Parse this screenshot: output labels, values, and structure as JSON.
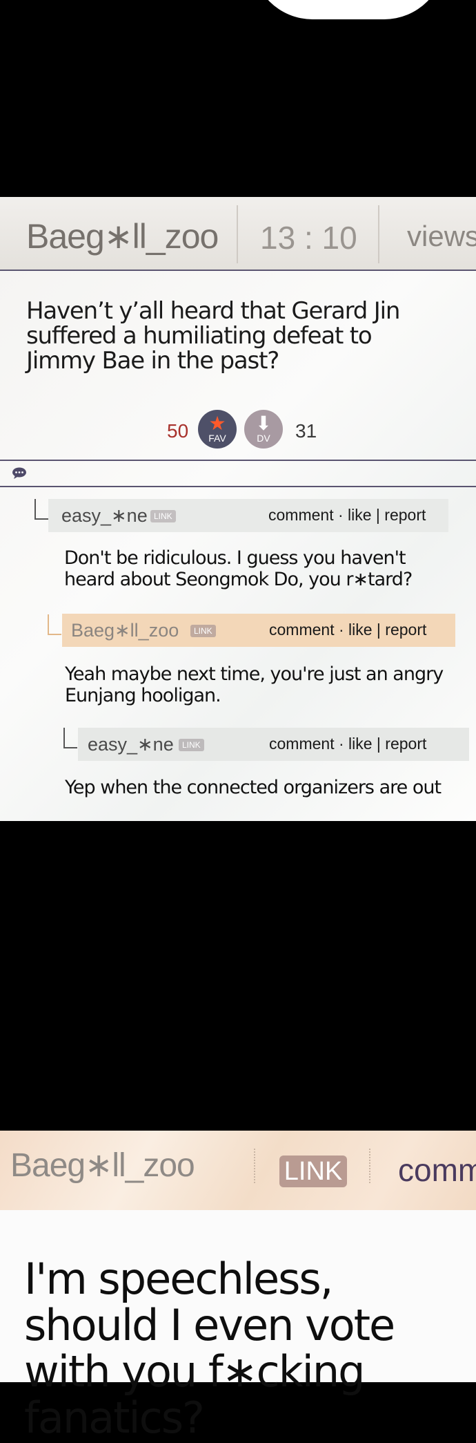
{
  "post1": {
    "author": "Baeg∗ll_zoo",
    "time": "13 : 10",
    "views_label": "views",
    "body": "Haven’t y’all heard that Gerard Jin suffered a humiliating defeat to Jimmy Bae in the past?",
    "fav_count": "50",
    "fav_label": "FAV",
    "dv_count": "31",
    "dv_label": "DV",
    "comments": [
      {
        "author": "easy_∗ne",
        "link": "LINK",
        "actions": "comment · like  | report",
        "text": "Don't be ridiculous. I guess you haven't heard about Seongmok Do, you r∗tard?"
      },
      {
        "author": "Baeg∗ll_zoo",
        "link": "LINK",
        "actions": "comment · like  | report",
        "text": "Yeah maybe next time, you're just an angry Eunjang hooligan."
      },
      {
        "author": "easy_∗ne",
        "link": "LINK",
        "actions": "comment · like  | report",
        "text": "Yep when the connected organizers are out"
      }
    ]
  },
  "post2": {
    "author": "Baeg∗ll_zoo",
    "link": "LINK",
    "comment_label": "comm",
    "body": "I'm speechless, should I even vote with you f∗cking fanatics?"
  },
  "colors": {
    "header_line": "#5a5470",
    "fav": "#4e5068",
    "dv": "#a89aa2",
    "highlight": "#f3d7b8"
  }
}
